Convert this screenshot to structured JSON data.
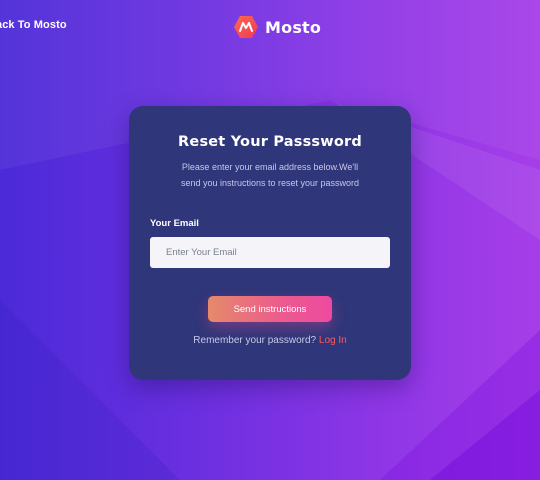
{
  "colors": {
    "background_start": "#4b2ad8",
    "background_end": "#a63ee8",
    "card": "#2f3679",
    "button_start": "#e58a6a",
    "button_end": "#ee4aa0",
    "link": "#ff5a5f"
  },
  "nav": {
    "back_label": "ack To Mosto"
  },
  "brand": {
    "name": "Mosto",
    "icon": "mosto-logo-icon"
  },
  "form": {
    "title": "Reset Your Passsword",
    "description_line1": "Please enter your email address below.We'll",
    "description_line2": "send you instructions to reset your password",
    "email_label": "Your Email",
    "email_placeholder": "Enter Your Email",
    "email_value": "",
    "submit_label": "Send instructions",
    "remember_text": "Remember your password?",
    "login_label": "Log In"
  }
}
